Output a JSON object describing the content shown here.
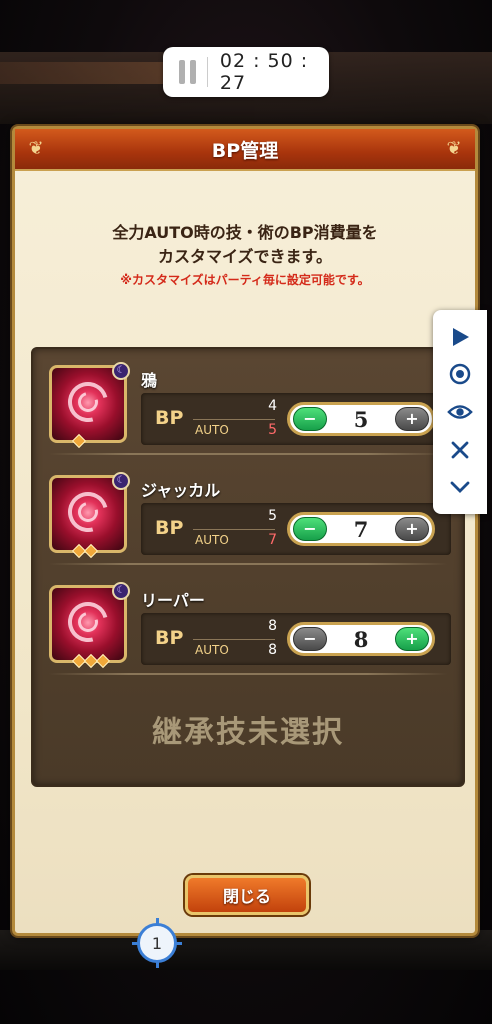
{
  "timer": {
    "time": "02 : 50 : 27",
    "icon": "pause-icon"
  },
  "dialog": {
    "title": "BP管理",
    "description_line1": "全力AUTO時の技・術のBP消費量を",
    "description_line2": "カスタマイズできます。",
    "note": "※カスタマイズはパーティ毎に設定可能です。",
    "skills": [
      {
        "name": "鴉",
        "bp_label": "BP",
        "auto_label": "AUTO",
        "bp_normal": "4",
        "bp_auto": "5",
        "value": "5",
        "rank": 1,
        "minus_enabled": true,
        "plus_enabled": false
      },
      {
        "name": "ジャッカル",
        "bp_label": "BP",
        "auto_label": "AUTO",
        "bp_normal": "5",
        "bp_auto": "7",
        "value": "7",
        "rank": 2,
        "minus_enabled": true,
        "plus_enabled": false
      },
      {
        "name": "リーパー",
        "bp_label": "BP",
        "auto_label": "AUTO",
        "bp_normal": "8",
        "bp_auto": "8",
        "value": "8",
        "rank": 3,
        "minus_enabled": false,
        "plus_enabled": true
      }
    ],
    "unselected_text": "継承技未選択",
    "close_label": "閉じる",
    "minus_symbol": "−",
    "plus_symbol": "+"
  },
  "sidebar": {
    "icons": [
      "play-icon",
      "record-icon",
      "eye-icon",
      "close-icon",
      "chevron-down-icon"
    ]
  },
  "marker": {
    "label": "1"
  },
  "colors": {
    "header": "#b8400f",
    "panel": "#52402c",
    "accent_red": "#d42a1a",
    "marker_blue": "#3b7fd6"
  }
}
